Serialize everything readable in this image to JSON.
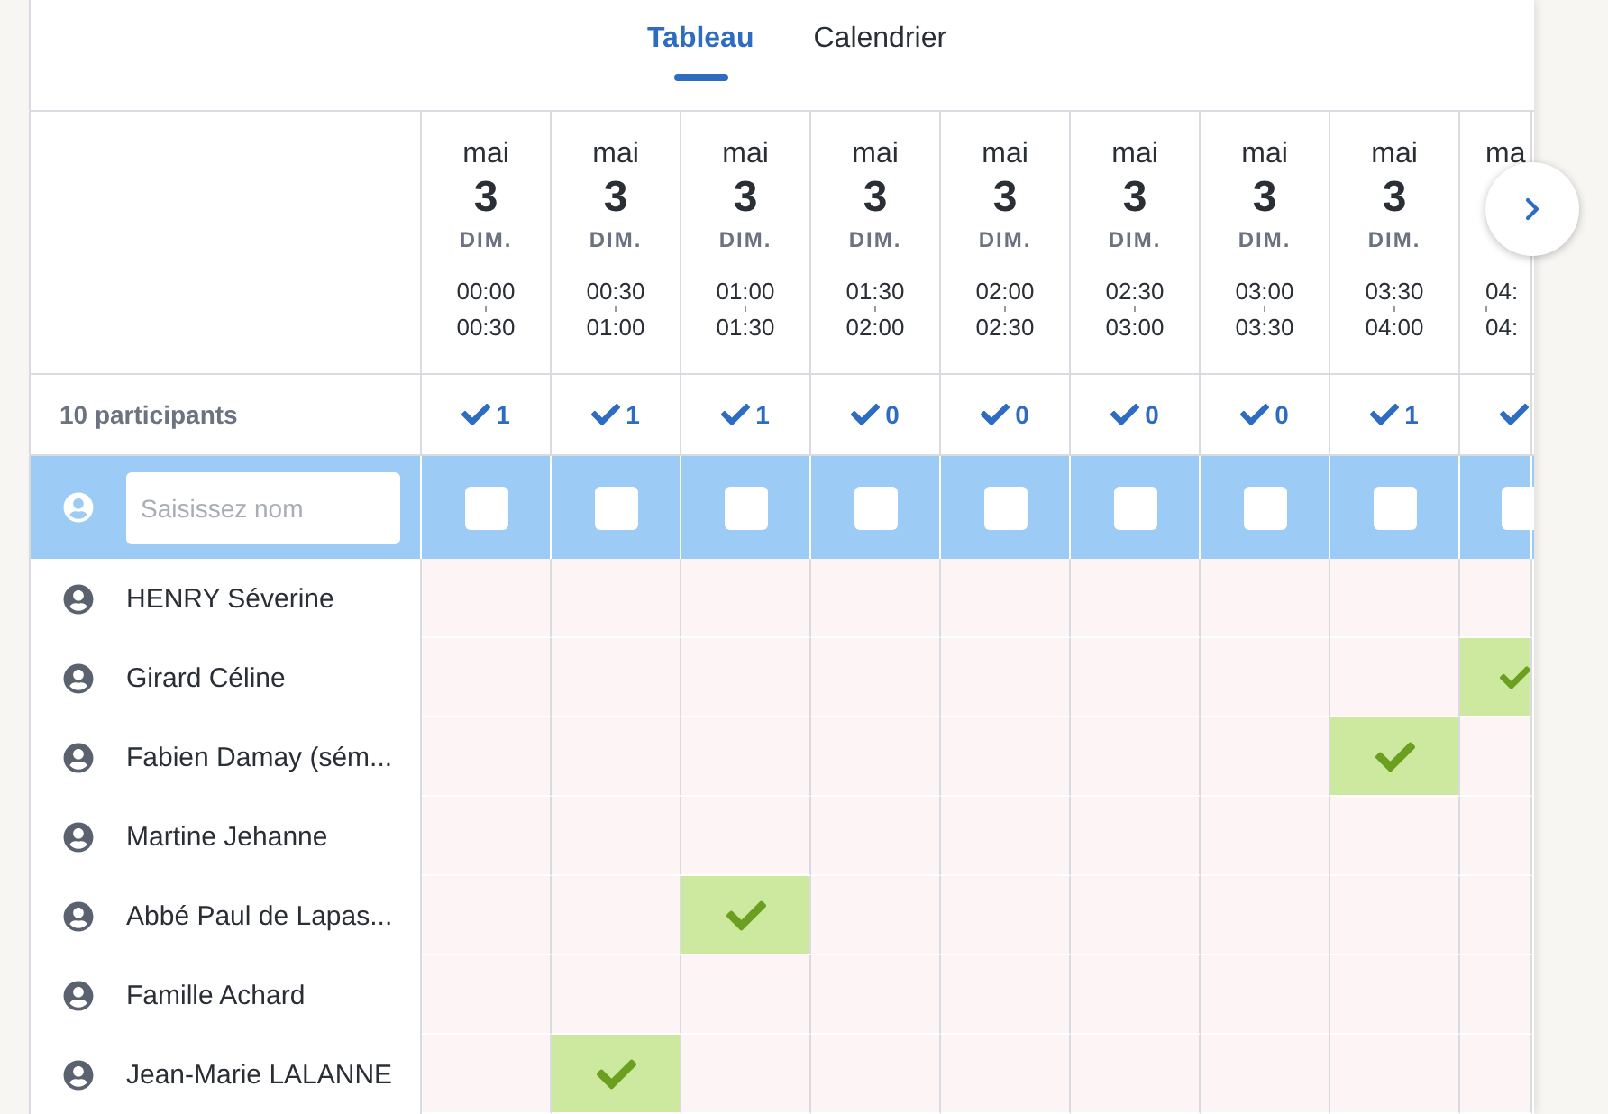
{
  "tabs": [
    {
      "label": "Tableau",
      "selected": true
    },
    {
      "label": "Calendrier",
      "selected": false
    }
  ],
  "participants_count": "10 participants",
  "slots": [
    {
      "month": "mai",
      "day": "3",
      "weekday": "DIM.",
      "start": "00:00",
      "end": "00:30",
      "count": "1"
    },
    {
      "month": "mai",
      "day": "3",
      "weekday": "DIM.",
      "start": "00:30",
      "end": "01:00",
      "count": "1"
    },
    {
      "month": "mai",
      "day": "3",
      "weekday": "DIM.",
      "start": "01:00",
      "end": "01:30",
      "count": "1"
    },
    {
      "month": "mai",
      "day": "3",
      "weekday": "DIM.",
      "start": "01:30",
      "end": "02:00",
      "count": "0"
    },
    {
      "month": "mai",
      "day": "3",
      "weekday": "DIM.",
      "start": "02:00",
      "end": "02:30",
      "count": "0"
    },
    {
      "month": "mai",
      "day": "3",
      "weekday": "DIM.",
      "start": "02:30",
      "end": "03:00",
      "count": "0"
    },
    {
      "month": "mai",
      "day": "3",
      "weekday": "DIM.",
      "start": "03:00",
      "end": "03:30",
      "count": "0"
    },
    {
      "month": "mai",
      "day": "3",
      "weekday": "DIM.",
      "start": "03:30",
      "end": "04:00",
      "count": "1"
    },
    {
      "month": "ma",
      "start": "04:",
      "end": "04:"
    }
  ],
  "new_entry": {
    "placeholder": "Saisissez nom",
    "checks": [
      false,
      false,
      false,
      false,
      false,
      false,
      false,
      false,
      false
    ]
  },
  "participants": [
    {
      "name": "HENRY Séverine",
      "votes": [
        false,
        false,
        false,
        false,
        false,
        false,
        false,
        false,
        false
      ]
    },
    {
      "name": "Girard Céline",
      "votes": [
        false,
        false,
        false,
        false,
        false,
        false,
        false,
        false,
        true
      ]
    },
    {
      "name": "Fabien Damay (sém...",
      "votes": [
        false,
        false,
        false,
        false,
        false,
        false,
        false,
        true,
        false
      ]
    },
    {
      "name": "Martine Jehanne",
      "votes": [
        false,
        false,
        false,
        false,
        false,
        false,
        false,
        false,
        false
      ]
    },
    {
      "name": "Abbé Paul de Lapas...",
      "votes": [
        false,
        false,
        true,
        false,
        false,
        false,
        false,
        false,
        false
      ]
    },
    {
      "name": "Famille Achard",
      "votes": [
        false,
        false,
        false,
        false,
        false,
        false,
        false,
        false,
        false
      ]
    },
    {
      "name": "Jean-Marie LALANNE",
      "votes": [
        false,
        true,
        false,
        false,
        false,
        false,
        false,
        false,
        false
      ]
    }
  ]
}
